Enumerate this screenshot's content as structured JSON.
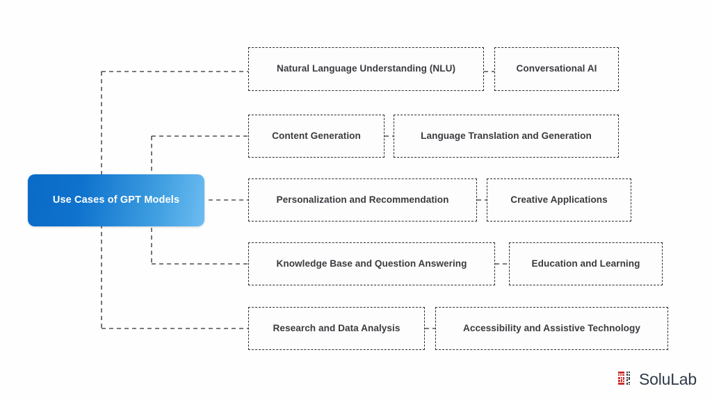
{
  "diagram": {
    "type": "mind-map",
    "root": {
      "label": "Use Cases of GPT Models"
    },
    "branches": [
      {
        "primary": "Natural Language Understanding (NLU)",
        "secondary": "Conversational AI"
      },
      {
        "primary": "Content Generation",
        "secondary": "Language Translation and Generation"
      },
      {
        "primary": "Personalization and Recommendation",
        "secondary": "Creative Applications"
      },
      {
        "primary": "Knowledge Base and Question Answering",
        "secondary": "Education and Learning"
      },
      {
        "primary": "Research and Data Analysis",
        "secondary": "Accessibility and Assistive Technology"
      }
    ]
  },
  "branding": {
    "name": "SoluLab",
    "mark": "qr-code-logo-icon"
  },
  "colors": {
    "background": "#fefefe",
    "root_gradient_start": "#0a6bc7",
    "root_gradient_end": "#6dbcf1",
    "root_text": "#ffffff",
    "node_border": "#2b2b33",
    "node_text": "#3b3b40",
    "logo_mark": "#c9302c",
    "logo_text": "#2f3a47"
  }
}
